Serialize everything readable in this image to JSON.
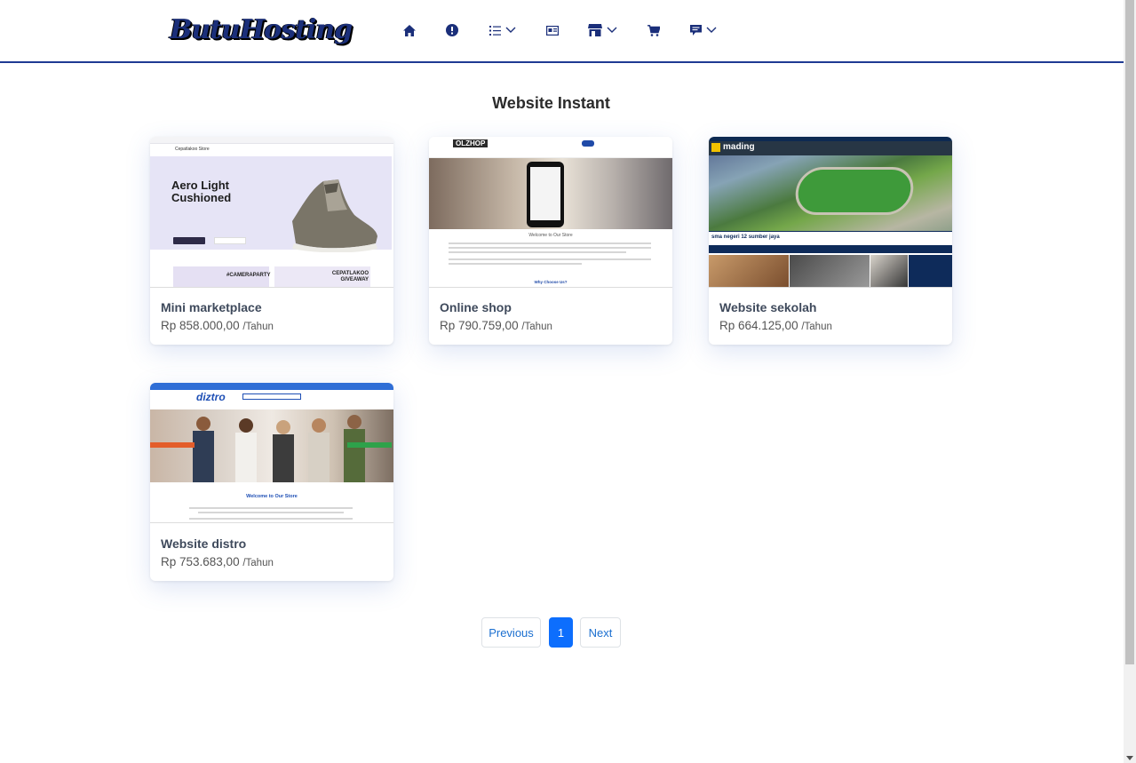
{
  "header": {
    "logo_text": "ButuHosting",
    "nav": [
      {
        "icon": "home-icon",
        "has_dropdown": false
      },
      {
        "icon": "info-circle-icon",
        "has_dropdown": false
      },
      {
        "icon": "list-icon",
        "has_dropdown": true
      },
      {
        "icon": "id-card-icon",
        "has_dropdown": false
      },
      {
        "icon": "store-icon",
        "has_dropdown": true
      },
      {
        "icon": "cart-icon",
        "has_dropdown": false
      },
      {
        "icon": "comment-icon",
        "has_dropdown": true
      }
    ],
    "accent_color": "#1f3a93"
  },
  "main": {
    "title": "Website Instant",
    "products": [
      {
        "name": "Mini marketplace",
        "price": "Rp 858.000,00",
        "period": "/Tahun",
        "preview": {
          "brand": "Cepatlakoo Store",
          "headline_1": "Aero Light",
          "headline_2": "Cushioned",
          "promo_1": "#CAMERAPARTY",
          "promo_2": "CEPATLAKOO GIVEAWAY"
        }
      },
      {
        "name": "Online shop",
        "price": "Rp 790.759,00",
        "period": "/Tahun",
        "preview": {
          "brand": "OLZHOP",
          "welcome": "Welcome to Our Store",
          "why": "Why Choose Us?"
        }
      },
      {
        "name": "Website sekolah",
        "price": "Rp 664.125,00",
        "period": "/Tahun",
        "preview": {
          "brand": "mading",
          "school": "sma negeri 12 sumber jaya"
        }
      },
      {
        "name": "Website distro",
        "price": "Rp 753.683,00",
        "period": "/Tahun",
        "preview": {
          "brand": "diztro",
          "welcome": "Welcome to Our Store"
        }
      }
    ]
  },
  "pagination": {
    "previous": "Previous",
    "current": "1",
    "next": "Next"
  }
}
